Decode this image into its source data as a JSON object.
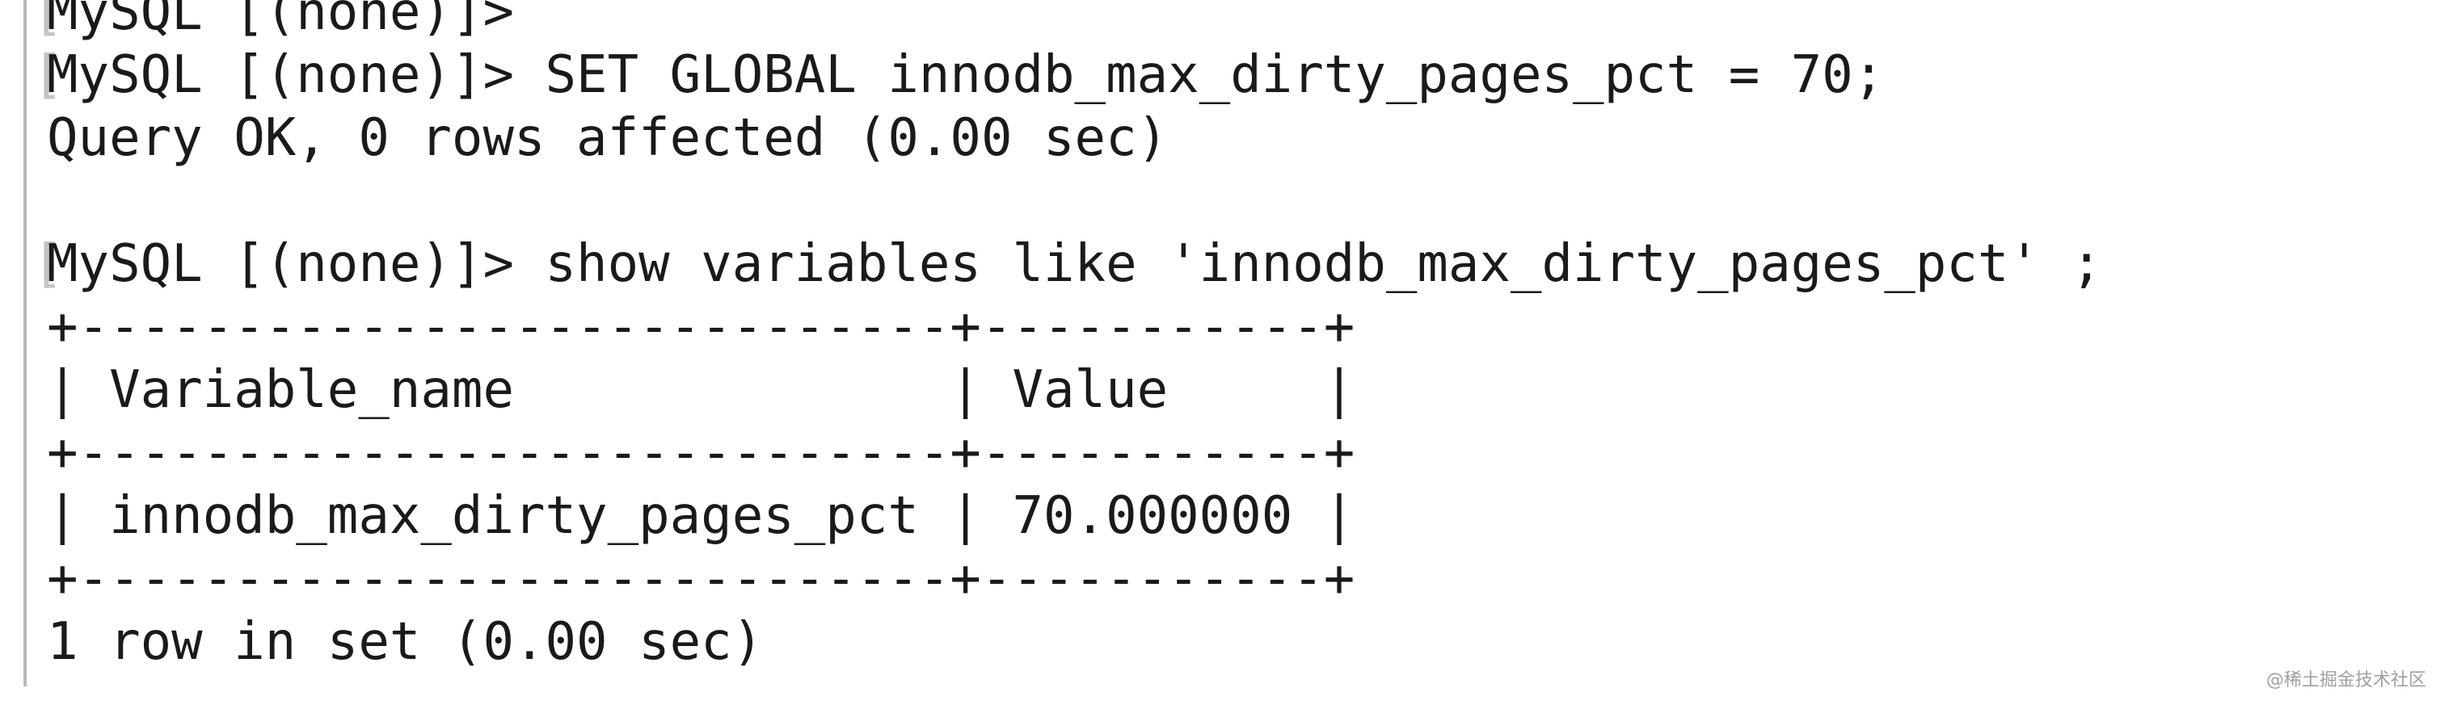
{
  "terminal": {
    "lines": [
      {
        "text": "MySQL [(none)]>",
        "bracket": true,
        "partial": true
      },
      {
        "text": "MySQL [(none)]> SET GLOBAL innodb_max_dirty_pages_pct = 70;",
        "bracket": true
      },
      {
        "text": "Query OK, 0 rows affected (0.00 sec)",
        "bracket": false
      },
      {
        "text": "",
        "bracket": false
      },
      {
        "text": "MySQL [(none)]> show variables like 'innodb_max_dirty_pages_pct' ;",
        "bracket": true
      },
      {
        "text": "+----------------------------+-----------+",
        "bracket": false
      },
      {
        "text": "| Variable_name              | Value     |",
        "bracket": false
      },
      {
        "text": "+----------------------------+-----------+",
        "bracket": false
      },
      {
        "text": "| innodb_max_dirty_pages_pct | 70.000000 |",
        "bracket": false
      },
      {
        "text": "+----------------------------+-----------+",
        "bracket": false
      },
      {
        "text": "1 row in set (0.00 sec)",
        "bracket": false
      }
    ],
    "bracket_char": "["
  },
  "watermark": "@稀土掘金技术社区"
}
